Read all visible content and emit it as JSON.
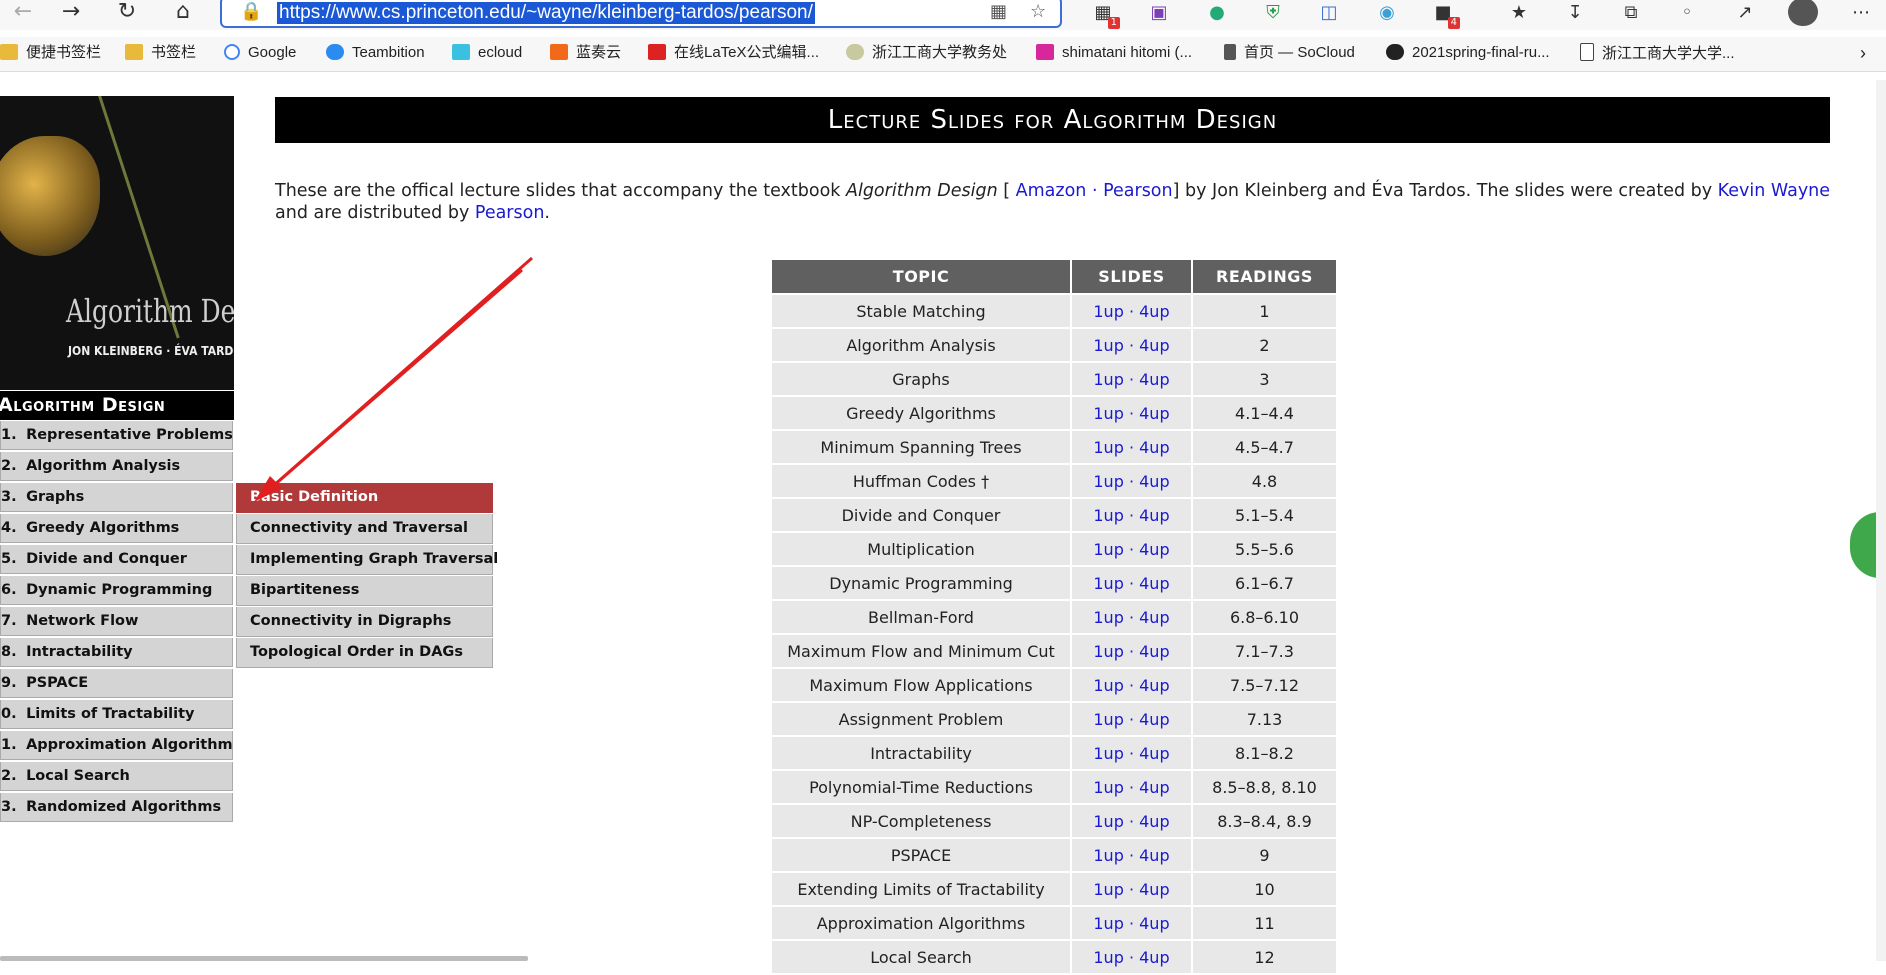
{
  "browser": {
    "url": "https://www.cs.princeton.edu/~wayne/kleinberg-tardos/pearson/",
    "extension_badges": {
      "ext1": "1",
      "ext2": "4"
    },
    "bookmarks": [
      "便捷书签栏",
      "书签栏",
      "Google",
      "Teambition",
      "ecloud",
      "蓝奏云",
      "在线LaTeX公式编辑...",
      "浙江工商大学教务处",
      "shimatani hitomi (...",
      "首页 — SoCloud",
      "2021spring-final-ru...",
      "浙江工商大学大学..."
    ]
  },
  "cover": {
    "title": "Algorithm Design",
    "authors": "JON KLEINBERG · ÉVA TARDOS"
  },
  "menu": {
    "title": "Algorithm Design",
    "items": [
      {
        "num": "1.",
        "label": "Representative Problems"
      },
      {
        "num": "2.",
        "label": "Algorithm Analysis"
      },
      {
        "num": "3.",
        "label": "Graphs"
      },
      {
        "num": "4.",
        "label": "Greedy Algorithms"
      },
      {
        "num": "5.",
        "label": "Divide and Conquer"
      },
      {
        "num": "6.",
        "label": "Dynamic Programming"
      },
      {
        "num": "7.",
        "label": "Network Flow"
      },
      {
        "num": "8.",
        "label": "Intractability"
      },
      {
        "num": "9.",
        "label": "PSPACE"
      },
      {
        "num": "0.",
        "label": "Limits of Tractability"
      },
      {
        "num": "1.",
        "label": "Approximation Algorithms"
      },
      {
        "num": "2.",
        "label": "Local Search"
      },
      {
        "num": "3.",
        "label": "Randomized Algorithms"
      }
    ],
    "submenu": [
      "Basic Definition",
      "Connectivity and Traversal",
      "Implementing Graph Traversal",
      "Bipartiteness",
      "Connectivity in Digraphs",
      "Topological Order in DAGs"
    ]
  },
  "page": {
    "banner": "Lecture Slides for Algorithm Design",
    "intro": {
      "t1": "These are the offical lecture slides that accompany the textbook ",
      "book": "Algorithm Design",
      "t2": " [ ",
      "amazon": "Amazon",
      "dot": " · ",
      "pearson": "Pearson",
      "t3": "] by Jon Kleinberg and Éva Tardos. The slides were created by ",
      "kevin": "Kevin Wayne",
      "t4": " and are distributed by ",
      "pearson2": "Pearson",
      "t5": "."
    }
  },
  "table": {
    "headers": [
      "TOPIC",
      "SLIDES",
      "READINGS"
    ],
    "rows": [
      {
        "topic": "Stable Matching",
        "readings": "1"
      },
      {
        "topic": "Algorithm Analysis",
        "readings": "2"
      },
      {
        "topic": "Graphs",
        "readings": "3"
      },
      {
        "topic": "Greedy Algorithms",
        "readings": "4.1–4.4"
      },
      {
        "topic": "Minimum Spanning Trees",
        "readings": "4.5–4.7"
      },
      {
        "topic": "Huffman Codes †",
        "readings": "4.8"
      },
      {
        "topic": "Divide and Conquer",
        "readings": "5.1–5.4"
      },
      {
        "topic": "Multiplication",
        "readings": "5.5–5.6"
      },
      {
        "topic": "Dynamic Programming",
        "readings": "6.1–6.7"
      },
      {
        "topic": "Bellman-Ford",
        "readings": "6.8–6.10"
      },
      {
        "topic": "Maximum Flow and Minimum Cut",
        "readings": "7.1–7.3"
      },
      {
        "topic": "Maximum Flow Applications",
        "readings": "7.5–7.12"
      },
      {
        "topic": "Assignment Problem",
        "readings": "7.13"
      },
      {
        "topic": "Intractability",
        "readings": "8.1–8.2"
      },
      {
        "topic": "Polynomial-Time Reductions",
        "readings": "8.5–8.8, 8.10"
      },
      {
        "topic": "NP-Completeness",
        "readings": "8.3–8.4, 8.9"
      },
      {
        "topic": "PSPACE",
        "readings": "9"
      },
      {
        "topic": "Extending Limits of Tractability",
        "readings": "10"
      },
      {
        "topic": "Approximation Algorithms",
        "readings": "11"
      },
      {
        "topic": "Local Search",
        "readings": "12"
      }
    ],
    "slide_links": {
      "one": "1up",
      "sep": " · ",
      "four": "4up"
    }
  },
  "colors": {
    "link": "#1a1ad0",
    "active_submenu": "#b03a3a",
    "arrow": "#e02020",
    "header": "#606060"
  }
}
